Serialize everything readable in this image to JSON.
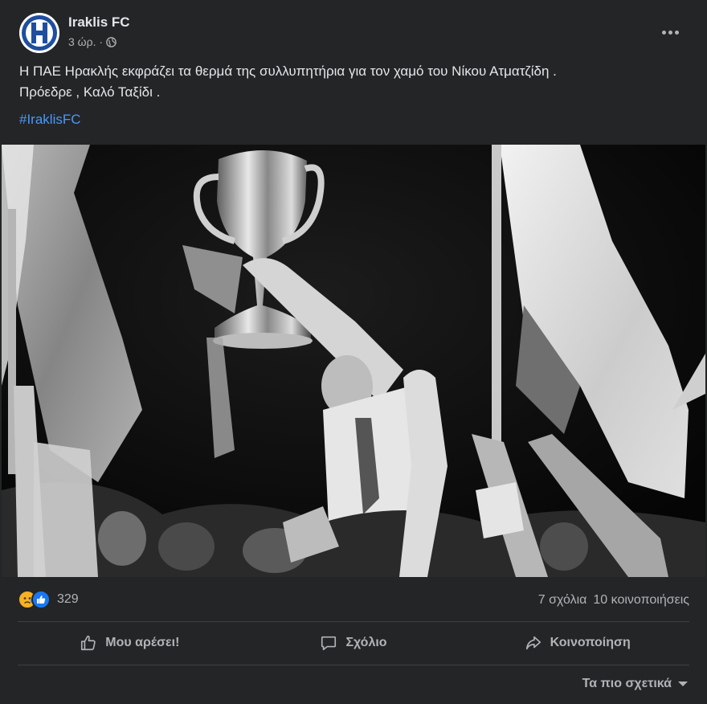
{
  "post": {
    "page_name": "Iraklis FC",
    "timestamp": "3 ώρ. ·",
    "text_line1": "Η ΠΑΕ Ηρακλής εκφράζει τα θερμά της συλλυπητήρια για τον χαμό του Νίκου Ατματζίδη .",
    "text_line2": "Πρόεδρε , Καλό Ταξίδι .",
    "hashtag": "#IraklisFC",
    "privacy_icon": "globe-icon"
  },
  "stats": {
    "reaction_count": "329",
    "reactions": [
      "sad-reaction-icon",
      "like-reaction-icon"
    ],
    "comments": "7 σχόλια",
    "shares": "10 κοινοποιήσεις"
  },
  "actions": {
    "like_label": "Μου αρέσει!",
    "comment_label": "Σχόλιο",
    "share_label": "Κοινοποίηση"
  },
  "sort": {
    "label": "Τα πιο σχετικά"
  },
  "colors": {
    "background": "#242526",
    "text_primary": "#e4e6eb",
    "text_secondary": "#b0b3b8",
    "link": "#4599ff",
    "divider": "#3e4042",
    "avatar_blue": "#1f4e9e"
  }
}
